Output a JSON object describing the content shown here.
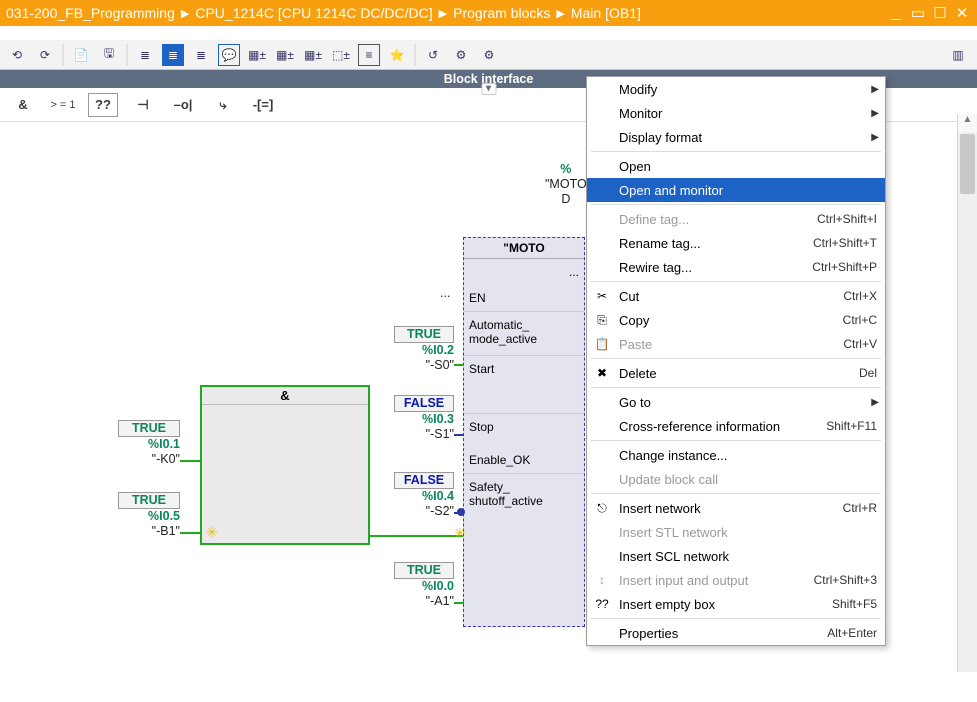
{
  "crumbs": [
    "031-200_FB_Programming",
    "CPU_1214C [CPU 1214C DC/DC/DC]",
    "Program blocks",
    "Main [OB1]"
  ],
  "interface_label": "Block interface",
  "oprow": {
    "and": "&",
    "ge1": "> = 1",
    "box": "??",
    "neg": "⊣",
    "negout": "–o|",
    "branch": "⤷",
    "assign": "-[=]"
  },
  "blocks": {
    "db_name": "\"MOTO",
    "db_sym": "%",
    "fb_name": "\"MOTO",
    "and": "&",
    "ports": {
      "en": "EN",
      "auto": "Automatic_ mode_active",
      "start": "Start",
      "stop": "Stop",
      "enok": "Enable_OK",
      "safety": "Safety_ shutoff_active",
      "dots": "..."
    }
  },
  "tags": {
    "k0": {
      "v": "TRUE",
      "a": "%I0.1",
      "n": "\"-K0\""
    },
    "b1": {
      "v": "TRUE",
      "a": "%I0.5",
      "n": "\"-B1\""
    },
    "s0": {
      "v": "TRUE",
      "a": "%I0.2",
      "n": "\"-S0\""
    },
    "s1": {
      "v": "FALSE",
      "a": "%I0.3",
      "n": "\"-S1\""
    },
    "s2": {
      "v": "FALSE",
      "a": "%I0.4",
      "n": "\"-S2\""
    },
    "a1": {
      "v": "TRUE",
      "a": "%I0.0",
      "n": "\"-A1\""
    }
  },
  "menu": [
    {
      "t": "item",
      "label": "Modify",
      "sub": true
    },
    {
      "t": "item",
      "label": "Monitor",
      "sub": true
    },
    {
      "t": "item",
      "label": "Display format",
      "sub": true
    },
    {
      "t": "sep"
    },
    {
      "t": "item",
      "label": "Open"
    },
    {
      "t": "item",
      "label": "Open and monitor",
      "hl": true
    },
    {
      "t": "sep"
    },
    {
      "t": "item",
      "label": "Define tag...",
      "kb": "Ctrl+Shift+I",
      "disabled": true
    },
    {
      "t": "item",
      "label": "Rename tag...",
      "kb": "Ctrl+Shift+T"
    },
    {
      "t": "item",
      "label": "Rewire tag...",
      "kb": "Ctrl+Shift+P"
    },
    {
      "t": "sep"
    },
    {
      "t": "item",
      "label": "Cut",
      "kb": "Ctrl+X",
      "icon": "✂"
    },
    {
      "t": "item",
      "label": "Copy",
      "kb": "Ctrl+C",
      "icon": "⎘"
    },
    {
      "t": "item",
      "label": "Paste",
      "kb": "Ctrl+V",
      "icon": "📋",
      "disabled": true
    },
    {
      "t": "sep"
    },
    {
      "t": "item",
      "label": "Delete",
      "kb": "Del",
      "icon": "✖"
    },
    {
      "t": "sep"
    },
    {
      "t": "item",
      "label": "Go to",
      "sub": true
    },
    {
      "t": "item",
      "label": "Cross-reference information",
      "kb": "Shift+F11"
    },
    {
      "t": "sep"
    },
    {
      "t": "item",
      "label": "Change instance..."
    },
    {
      "t": "item",
      "label": "Update block call",
      "disabled": true
    },
    {
      "t": "sep"
    },
    {
      "t": "item",
      "label": "Insert network",
      "kb": "Ctrl+R",
      "icon": "⎋"
    },
    {
      "t": "item",
      "label": "Insert STL network",
      "disabled": true
    },
    {
      "t": "item",
      "label": "Insert SCL network"
    },
    {
      "t": "item",
      "label": "Insert input and output",
      "kb": "Ctrl+Shift+3",
      "icon": "↕",
      "disabled": true
    },
    {
      "t": "item",
      "label": "Insert empty box",
      "kb": "Shift+F5",
      "icon": "??"
    },
    {
      "t": "sep"
    },
    {
      "t": "item",
      "label": "Properties",
      "kb": "Alt+Enter"
    }
  ]
}
